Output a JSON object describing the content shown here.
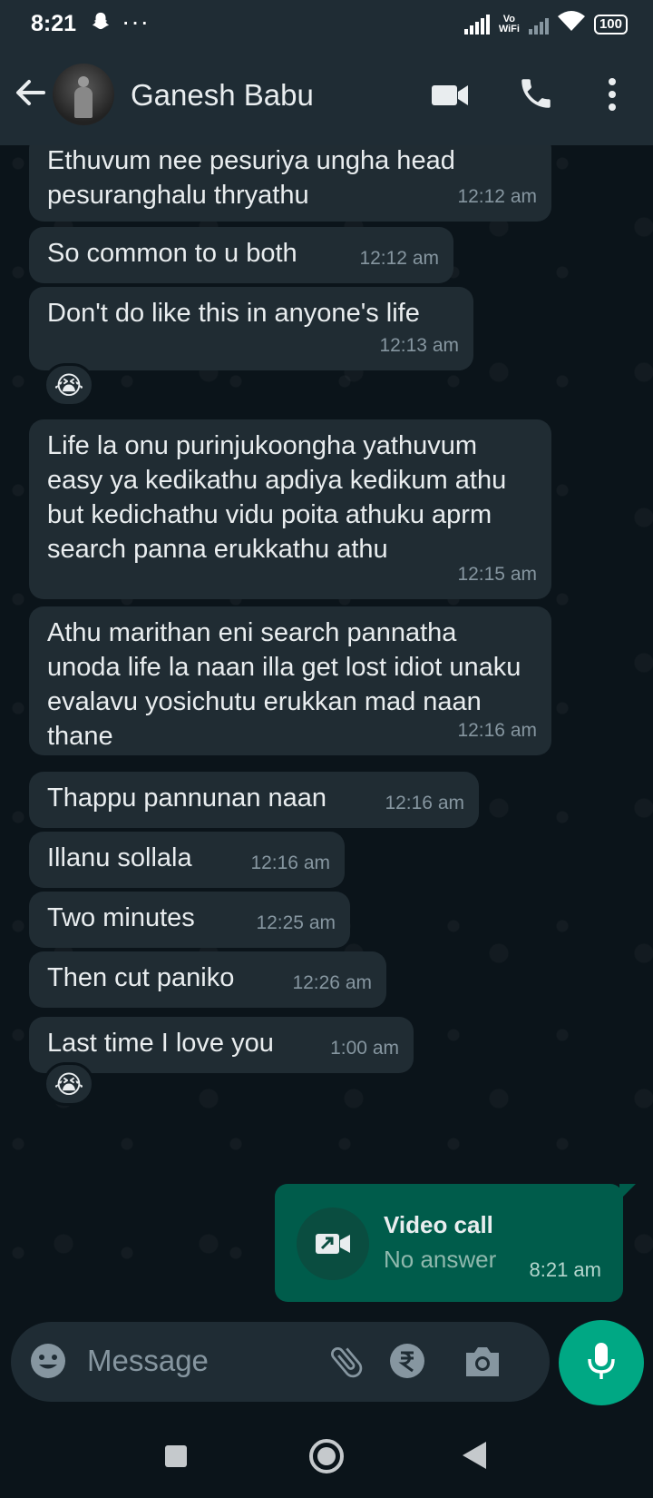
{
  "status_bar": {
    "time": "8:21",
    "dots": "···",
    "vowifi_top": "Vo",
    "vowifi_bottom": "WiFi",
    "battery": "100"
  },
  "header": {
    "contact_name": "Ganesh Babu"
  },
  "messages": [
    {
      "text": "Ethuvum nee pesuriya ungha head pesuranghalu thryathu",
      "time": "12:12 am"
    },
    {
      "text": "So common to u both",
      "time": "12:12 am"
    },
    {
      "text": "Don't do like this in anyone's life",
      "time": "12:13 am",
      "reaction": "😭"
    },
    {
      "text": "Life la onu purinjukoongha yathuvum easy ya kedikathu apdiya kedikum athu but kedichathu vidu poita athuku aprm search panna erukkathu athu",
      "time": "12:15 am"
    },
    {
      "text": "Athu marithan eni search pannatha unoda life la naan illa get lost idiot unaku evalavu yosichutu erukkan mad naan thane",
      "time": "12:16 am"
    },
    {
      "text": "Thappu pannunan naan",
      "time": "12:16 am"
    },
    {
      "text": "Illanu sollala",
      "time": "12:16 am"
    },
    {
      "text": "Two minutes",
      "time": "12:25 am"
    },
    {
      "text": "Then cut paniko",
      "time": "12:26 am"
    },
    {
      "text": "Last time I love you",
      "time": "1:00 am",
      "reaction": "😭"
    }
  ],
  "outgoing_call": {
    "title": "Video call",
    "status": "No answer",
    "time": "8:21 am"
  },
  "composer": {
    "placeholder": "Message"
  },
  "colors": {
    "incoming_bubble": "#202c33",
    "outgoing_bubble": "#005c4b",
    "accent": "#00a884"
  }
}
